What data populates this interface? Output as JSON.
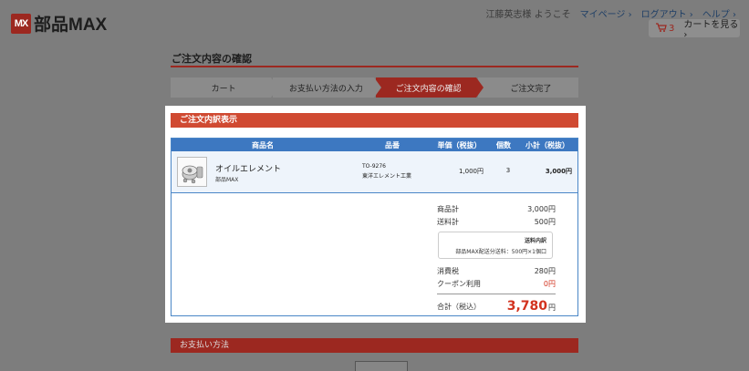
{
  "logo": {
    "mark": "MX",
    "name": "部品MAX"
  },
  "header": {
    "user_greeting": "江藤英志様 ようこそ",
    "links": [
      "マイページ",
      "ログアウト",
      "ヘルプ"
    ],
    "cart_count": "3",
    "cart_label": "カートを見る"
  },
  "page": {
    "title": "ご注文内容の確認"
  },
  "steps": [
    {
      "label": "カート"
    },
    {
      "label": "お支払い方法の入力"
    },
    {
      "label": "ご注文内容の確認",
      "active": true
    },
    {
      "label": "ご注文完了"
    }
  ],
  "order": {
    "section_title": "ご注文内訳表示",
    "columns": [
      "商品名",
      "品番",
      "単価（税抜）",
      "個数",
      "小計（税抜）"
    ],
    "items": [
      {
        "name": "オイルエレメント",
        "maker": "部品MAX",
        "code": "TO-9276",
        "manufacturer": "東洋エレメント工業",
        "unit_price": "1,000円",
        "qty": "3",
        "subtotal": "3,000円"
      }
    ],
    "summary": {
      "goods_label": "商品計",
      "goods_value": "3,000円",
      "shipping_label": "送料計",
      "shipping_value": "500円",
      "shipping_breakdown_title": "送料内訳",
      "shipping_breakdown_text": "部品MAX配送分送料：500円×1個口",
      "tax_label": "消費税",
      "tax_value": "280円",
      "coupon_label": "クーポン利用",
      "coupon_value": "0円",
      "total_label": "合計（税込）",
      "total_value": "3,780",
      "total_unit": "円"
    }
  },
  "payment": {
    "section_title": "お支払い方法"
  },
  "colors": {
    "brand_red": "#9c2820",
    "header_red": "#d04a32",
    "table_blue": "#3d78c1",
    "price_red": "#d2321e"
  }
}
